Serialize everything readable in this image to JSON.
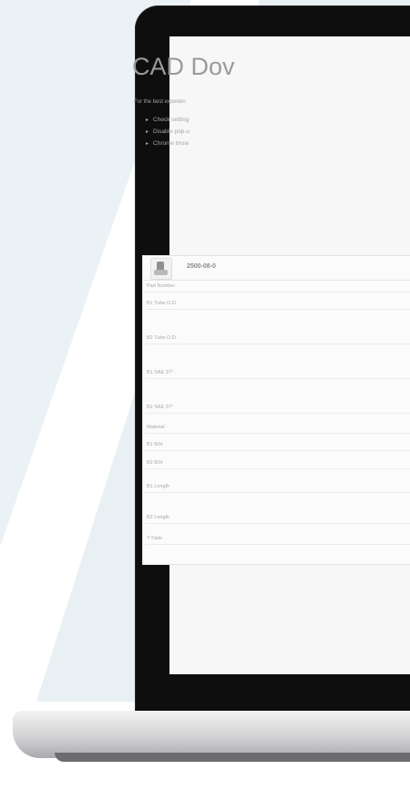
{
  "page": {
    "title": "CAD Dov",
    "intro": "For the best experien",
    "tips": [
      "Check setting",
      "Disable pop-u",
      "Chrome brow"
    ]
  },
  "card": {
    "part_number": "2500-08-0",
    "spec_labels": [
      "Part Number",
      "B1 Tube O.D.",
      "B2 Tube O.D.",
      "B1 SAE 37°",
      "B2 SAE 37°",
      "Material",
      "B1 B/H",
      "B2 B/H",
      "B1 Length",
      "B2 Length",
      "Y Flats"
    ]
  },
  "colors": {
    "bezel": "#0e0e0f",
    "screen_bg": "#f7f7f7",
    "background_accent": "#ebf2f5"
  }
}
